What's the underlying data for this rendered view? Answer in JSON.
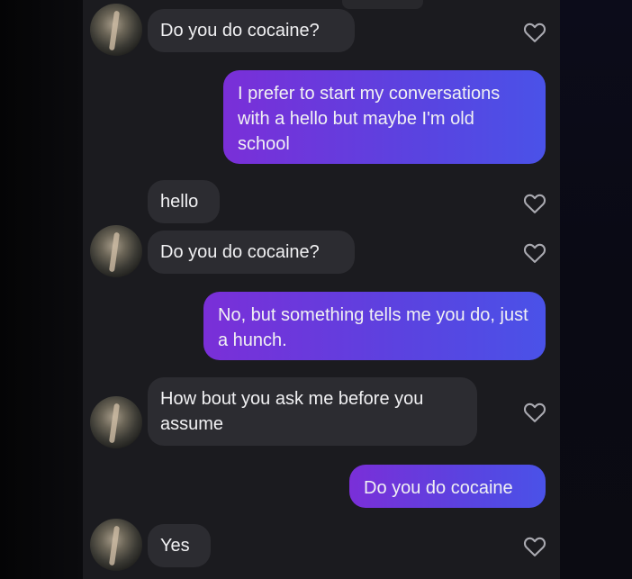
{
  "messages": [
    {
      "direction": "incoming",
      "text": "Do you do cocaine?"
    },
    {
      "direction": "outgoing",
      "text": "I prefer to start my conversations with a hello but maybe I'm old school"
    },
    {
      "direction": "incoming",
      "text": "hello"
    },
    {
      "direction": "incoming",
      "text": "Do you do cocaine?"
    },
    {
      "direction": "outgoing",
      "text": "No, but something tells me you do, just a hunch."
    },
    {
      "direction": "incoming",
      "text": "How bout you ask me before you assume"
    },
    {
      "direction": "outgoing",
      "text": "Do you do cocaine"
    },
    {
      "direction": "incoming",
      "text": "Yes"
    }
  ],
  "colors": {
    "incoming_bubble": "#2c2c31",
    "outgoing_gradient_start": "#7a2fd8",
    "outgoing_gradient_end": "#4a52e8",
    "background": "#1b1b1f"
  },
  "icons": {
    "like": "heart-outline-icon",
    "avatar": "profile-photo"
  }
}
